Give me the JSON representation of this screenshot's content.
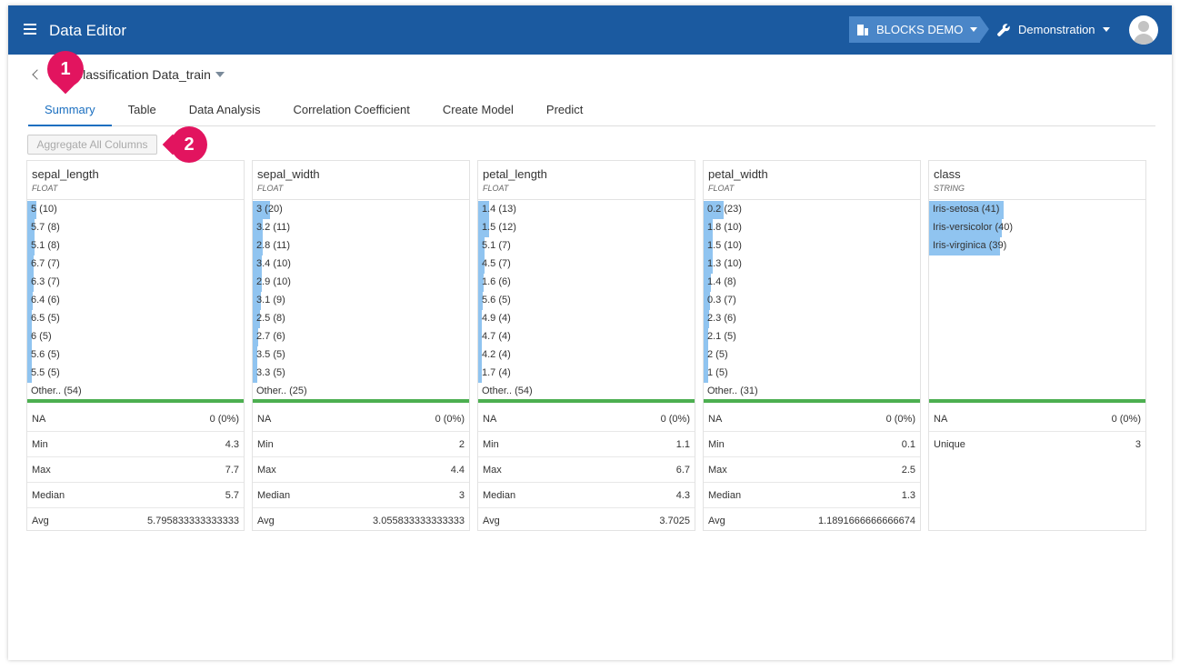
{
  "header": {
    "title": "Data Editor",
    "org": "BLOCKS DEMO",
    "project": "Demonstration"
  },
  "breadcrumb": {
    "dataset": "Classification Data_train"
  },
  "tabs": [
    "Summary",
    "Table",
    "Data Analysis",
    "Correlation Coefficient",
    "Create Model",
    "Predict"
  ],
  "toolbar": {
    "aggregate_label": "Aggregate All Columns"
  },
  "markers": [
    "1",
    "2"
  ],
  "columns": [
    {
      "name": "sepal_length",
      "type": "FLOAT",
      "values": [
        {
          "label": "5 (10)",
          "count": 10
        },
        {
          "label": "5.7 (8)",
          "count": 8
        },
        {
          "label": "5.1 (8)",
          "count": 8
        },
        {
          "label": "6.7 (7)",
          "count": 7
        },
        {
          "label": "6.3 (7)",
          "count": 7
        },
        {
          "label": "6.4 (6)",
          "count": 6
        },
        {
          "label": "6.5 (5)",
          "count": 5
        },
        {
          "label": "6 (5)",
          "count": 5
        },
        {
          "label": "5.6 (5)",
          "count": 5
        },
        {
          "label": "5.5 (5)",
          "count": 5
        }
      ],
      "other": "Other.. (54)",
      "stats": [
        {
          "label": "NA",
          "value": "0 (0%)"
        },
        {
          "label": "Min",
          "value": "4.3"
        },
        {
          "label": "Max",
          "value": "7.7"
        },
        {
          "label": "Median",
          "value": "5.7"
        },
        {
          "label": "Avg",
          "value": "5.795833333333333"
        }
      ]
    },
    {
      "name": "sepal_width",
      "type": "FLOAT",
      "values": [
        {
          "label": "3 (20)",
          "count": 20
        },
        {
          "label": "3.2 (11)",
          "count": 11
        },
        {
          "label": "2.8 (11)",
          "count": 11
        },
        {
          "label": "3.4 (10)",
          "count": 10
        },
        {
          "label": "2.9 (10)",
          "count": 10
        },
        {
          "label": "3.1 (9)",
          "count": 9
        },
        {
          "label": "2.5 (8)",
          "count": 8
        },
        {
          "label": "2.7 (6)",
          "count": 6
        },
        {
          "label": "3.5 (5)",
          "count": 5
        },
        {
          "label": "3.3 (5)",
          "count": 5
        }
      ],
      "other": "Other.. (25)",
      "stats": [
        {
          "label": "NA",
          "value": "0 (0%)"
        },
        {
          "label": "Min",
          "value": "2"
        },
        {
          "label": "Max",
          "value": "4.4"
        },
        {
          "label": "Median",
          "value": "3"
        },
        {
          "label": "Avg",
          "value": "3.055833333333333"
        }
      ]
    },
    {
      "name": "petal_length",
      "type": "FLOAT",
      "values": [
        {
          "label": "1.4 (13)",
          "count": 13
        },
        {
          "label": "1.5 (12)",
          "count": 12
        },
        {
          "label": "5.1 (7)",
          "count": 7
        },
        {
          "label": "4.5 (7)",
          "count": 7
        },
        {
          "label": "1.6 (6)",
          "count": 6
        },
        {
          "label": "5.6 (5)",
          "count": 5
        },
        {
          "label": "4.9 (4)",
          "count": 4
        },
        {
          "label": "4.7 (4)",
          "count": 4
        },
        {
          "label": "4.2 (4)",
          "count": 4
        },
        {
          "label": "1.7 (4)",
          "count": 4
        }
      ],
      "other": "Other.. (54)",
      "stats": [
        {
          "label": "NA",
          "value": "0 (0%)"
        },
        {
          "label": "Min",
          "value": "1.1"
        },
        {
          "label": "Max",
          "value": "6.7"
        },
        {
          "label": "Median",
          "value": "4.3"
        },
        {
          "label": "Avg",
          "value": "3.7025"
        }
      ]
    },
    {
      "name": "petal_width",
      "type": "FLOAT",
      "values": [
        {
          "label": "0.2 (23)",
          "count": 23
        },
        {
          "label": "1.8 (10)",
          "count": 10
        },
        {
          "label": "1.5 (10)",
          "count": 10
        },
        {
          "label": "1.3 (10)",
          "count": 10
        },
        {
          "label": "1.4 (8)",
          "count": 8
        },
        {
          "label": "0.3 (7)",
          "count": 7
        },
        {
          "label": "2.3 (6)",
          "count": 6
        },
        {
          "label": "2.1 (5)",
          "count": 5
        },
        {
          "label": "2 (5)",
          "count": 5
        },
        {
          "label": "1 (5)",
          "count": 5
        }
      ],
      "other": "Other.. (31)",
      "stats": [
        {
          "label": "NA",
          "value": "0 (0%)"
        },
        {
          "label": "Min",
          "value": "0.1"
        },
        {
          "label": "Max",
          "value": "2.5"
        },
        {
          "label": "Median",
          "value": "1.3"
        },
        {
          "label": "Avg",
          "value": "1.1891666666666674"
        }
      ]
    },
    {
      "name": "class",
      "type": "STRING",
      "values": [
        {
          "label": "Iris-setosa (41)",
          "count": 41
        },
        {
          "label": "Iris-versicolor (40)",
          "count": 40
        },
        {
          "label": "Iris-virginica (39)",
          "count": 39
        }
      ],
      "other": "",
      "stats": [
        {
          "label": "NA",
          "value": "0 (0%)"
        },
        {
          "label": "Unique",
          "value": "3"
        }
      ]
    }
  ]
}
